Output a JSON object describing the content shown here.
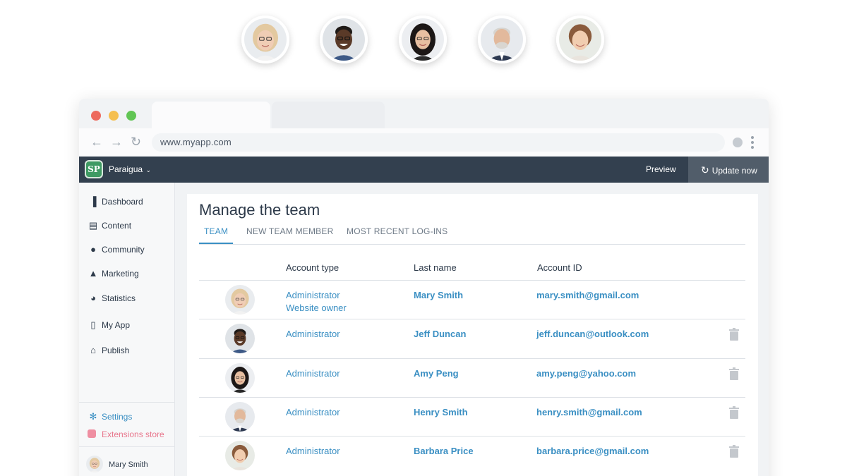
{
  "browser": {
    "url": "www.myapp.com",
    "nav_back": "←",
    "nav_forward": "→",
    "nav_reload": "↻"
  },
  "appbar": {
    "logo_text": "SP",
    "brand": "Paraigua",
    "preview": "Preview",
    "update_now": "Update now"
  },
  "sidebar": {
    "items": [
      {
        "label": "Dashboard",
        "icon": "bar-chart-icon"
      },
      {
        "label": "Content",
        "icon": "document-icon"
      },
      {
        "label": "Community",
        "icon": "person-icon"
      },
      {
        "label": "Marketing",
        "icon": "bell-icon"
      },
      {
        "label": "Statistics",
        "icon": "pie-chart-icon"
      },
      {
        "label": "My App",
        "icon": "phone-icon"
      },
      {
        "label": "Publish",
        "icon": "store-icon"
      }
    ],
    "settings": "Settings",
    "extensions": "Extensions store",
    "user_name": "Mary Smith"
  },
  "main": {
    "title": "Manage the team",
    "tabs": [
      "TEAM",
      "NEW TEAM MEMBER",
      "MOST RECENT LOG-INS"
    ],
    "active_tab": "TEAM",
    "columns": [
      "Account type",
      "Last name",
      "Account ID"
    ],
    "rows": [
      {
        "account_type": "Administrator",
        "account_type_2": "Website owner",
        "name": "Mary Smith",
        "id": "mary.smith@gmail.com",
        "deletable": false
      },
      {
        "account_type": "Administrator",
        "account_type_2": "",
        "name": "Jeff Duncan",
        "id": "jeff.duncan@outlook.com",
        "deletable": true
      },
      {
        "account_type": "Administrator",
        "account_type_2": "",
        "name": "Amy Peng",
        "id": "amy.peng@yahoo.com",
        "deletable": true
      },
      {
        "account_type": "Administrator",
        "account_type_2": "",
        "name": "Henry Smith",
        "id": "henry.smith@gmail.com",
        "deletable": true
      },
      {
        "account_type": "Administrator",
        "account_type_2": "",
        "name": "Barbara Price",
        "id": "barbara.price@gmail.com",
        "deletable": true
      }
    ]
  },
  "colors": {
    "accent": "#3a8fc3",
    "appbar": "#33404f",
    "update_button": "#515d6a",
    "extensions": "#e8768c"
  }
}
